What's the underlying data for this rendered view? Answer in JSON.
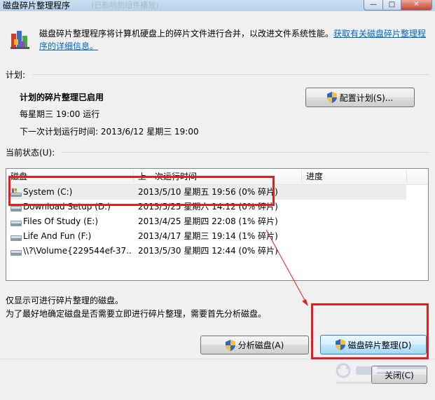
{
  "window": {
    "title": "磁盘碎片整理程序",
    "ghost_title": "(已影响到组件播放)",
    "min_label": "—",
    "max_label": "□",
    "close_label": "✕"
  },
  "intro": {
    "text": "磁盘碎片整理程序将计算机硬盘上的碎片文件进行合并，以改进文件系统性能。",
    "link": "获取有关磁盘碎片整理程序的详细信息。"
  },
  "schedule": {
    "section_label": "计划:",
    "status": "计划的碎片整理已启用",
    "frequency": "每星期三 19:00 运行",
    "next_run": "下一次计划运行时间: 2013/6/12 星期三 19:00",
    "configure_button": "配置计划(S)..."
  },
  "current_status": {
    "section_label": "当前状态(U):",
    "columns": [
      "磁盘",
      "上一次运行时间",
      "进度"
    ],
    "rows": [
      {
        "disk": "System (C:)",
        "last_run": "2013/5/10 星期五 19:56 (0% 碎片)",
        "progress": "",
        "icon": "system-drive-icon"
      },
      {
        "disk": "Download Setup (D:)",
        "last_run": "2013/5/25 星期六 14:12 (0% 碎片)",
        "progress": "",
        "icon": "drive-icon"
      },
      {
        "disk": "Files Of Study (E:)",
        "last_run": "2013/4/25 星期四 22:08 (1% 碎片)",
        "progress": "",
        "icon": "drive-icon"
      },
      {
        "disk": "Life And Fun (F:)",
        "last_run": "2013/4/17 星期三 19:14 (1% 碎片)",
        "progress": "",
        "icon": "drive-icon"
      },
      {
        "disk": "\\\\?\\Volume{229544ef-37...",
        "last_run": "2013/5/30 星期四 12:44 (0% 碎片)",
        "progress": "",
        "icon": "drive-icon"
      }
    ]
  },
  "notes": {
    "line1": "仅显示可进行碎片整理的磁盘。",
    "line2": "为了最好地确定磁盘是否需要立即进行碎片整理，需要首先分析磁盘。"
  },
  "actions": {
    "analyze_button": "分析磁盘(A)",
    "defrag_button": "磁盘碎片整理(D)",
    "close_button": "关闭(C)"
  },
  "colors": {
    "annotation_red": "#e02020",
    "link_blue": "#0066cc"
  }
}
